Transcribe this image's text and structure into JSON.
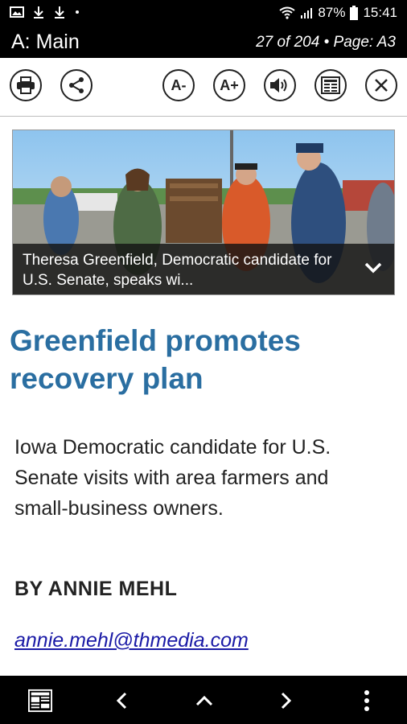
{
  "status_bar": {
    "icons": [
      "image-icon",
      "download-icon",
      "download-icon",
      "dot-icon"
    ],
    "wifi": "wifi-icon",
    "signal": "signal-icon",
    "battery_percent": "87%",
    "battery_icon": "battery-icon",
    "time": "15:41"
  },
  "header": {
    "section": "A: Main",
    "position": "27 of 204 • Page: A3"
  },
  "toolbar": {
    "print": "printer-icon",
    "share": "share-icon",
    "font_decrease": "A-",
    "font_increase": "A+",
    "audio": "speaker-icon",
    "view": "page-view-icon",
    "close": "close-icon"
  },
  "article": {
    "photo_caption": "Theresa Greenfield, Democratic candidate for U.S. Senate, speaks wi...",
    "headline": "Greenfield promotes recovery plan",
    "subheadline": "Iowa Democratic candidate for U.S. Senate visits with area farmers and small-business owners.",
    "byline": "BY ANNIE MEHL",
    "email": "annie.mehl@thmedia.com"
  },
  "bottom_nav": {
    "icons": [
      "page-thumbnail-icon",
      "previous-icon",
      "up-icon",
      "next-icon",
      "more-icon"
    ]
  }
}
